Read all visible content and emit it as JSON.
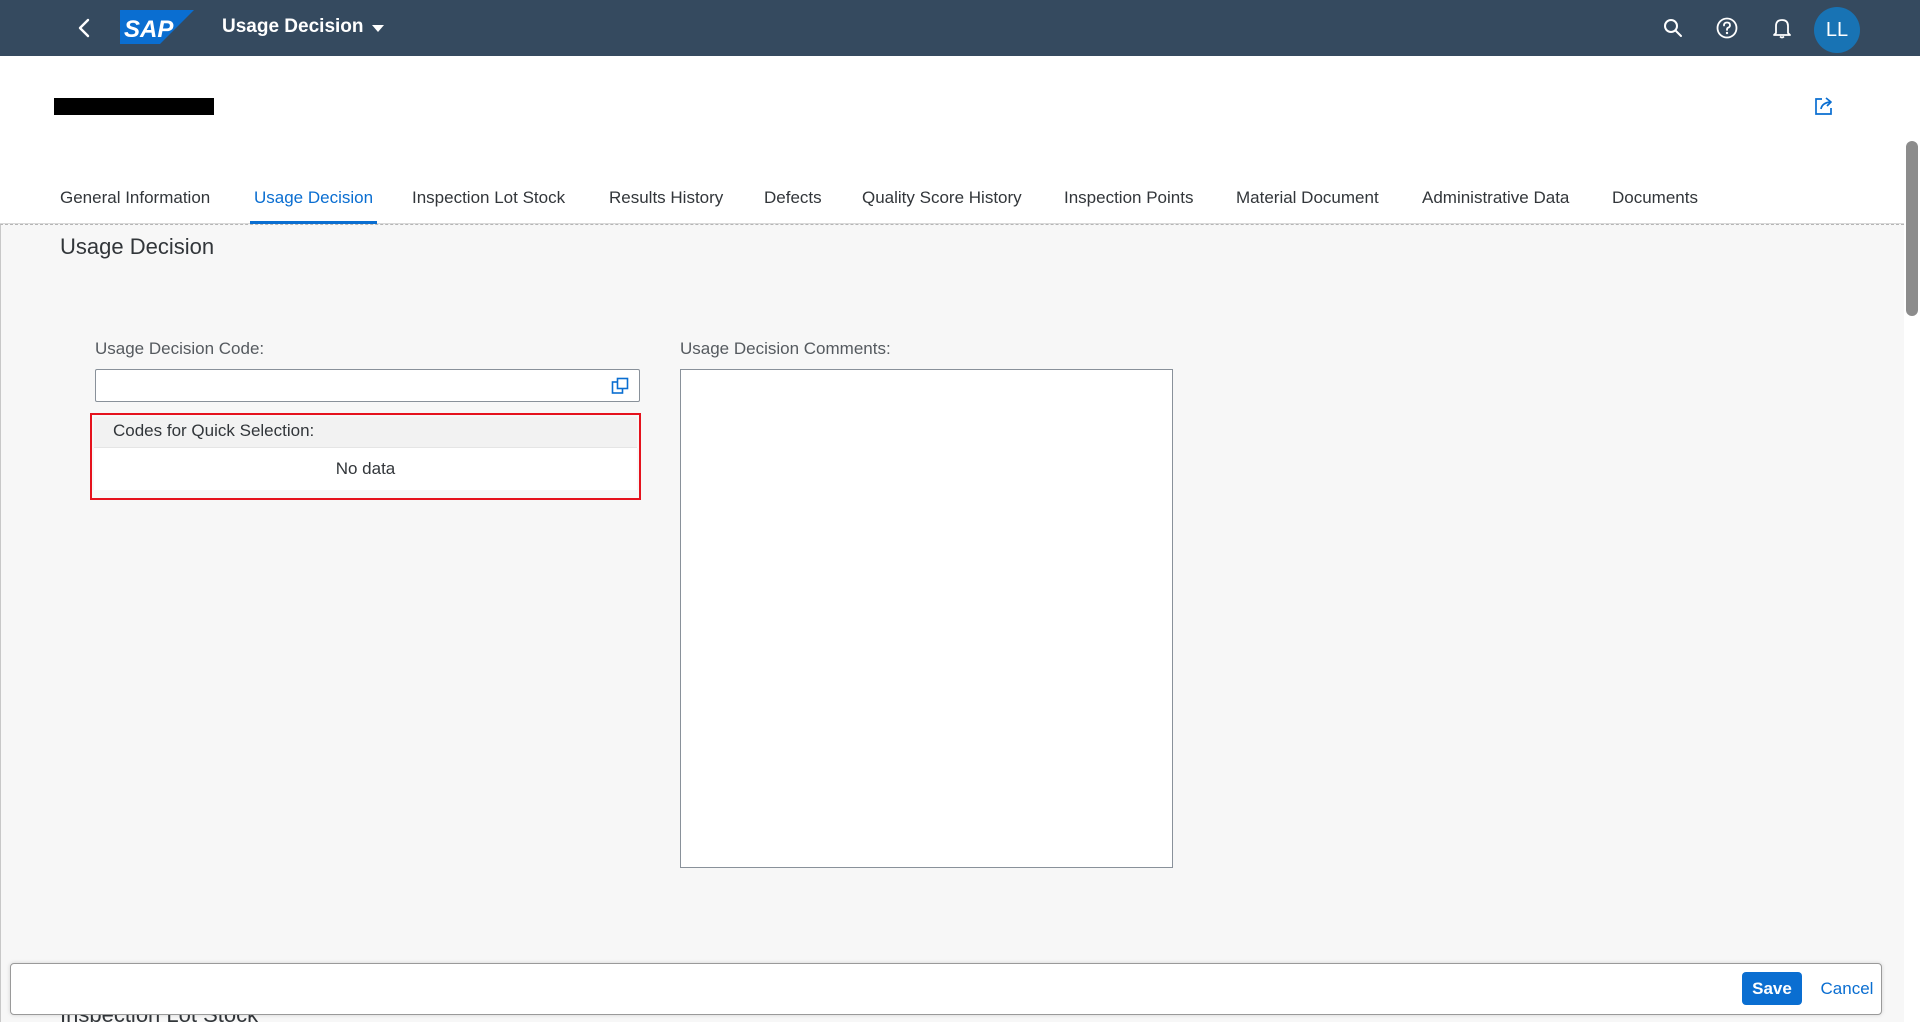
{
  "shell": {
    "app_title": "Usage Decision",
    "avatar_initials": "LL",
    "logo_text": "SAP",
    "icons": [
      "back-icon",
      "search-icon",
      "help-icon",
      "bell-icon",
      "share-icon",
      "value-help-icon"
    ]
  },
  "tabs": [
    {
      "label": "General Information",
      "active": false
    },
    {
      "label": "Usage Decision",
      "active": true
    },
    {
      "label": "Inspection Lot Stock",
      "active": false
    },
    {
      "label": "Results History",
      "active": false
    },
    {
      "label": "Defects",
      "active": false
    },
    {
      "label": "Quality Score History",
      "active": false
    },
    {
      "label": "Inspection Points",
      "active": false
    },
    {
      "label": "Material Document",
      "active": false
    },
    {
      "label": "Administrative Data",
      "active": false
    },
    {
      "label": "Documents",
      "active": false
    }
  ],
  "section": {
    "title": "Usage Decision",
    "code_label": "Usage Decision Code:",
    "code_value": "",
    "comments_label": "Usage Decision Comments:",
    "comments_value": "",
    "quick_selection_header": "Codes for Quick Selection:",
    "quick_selection_empty": "No data"
  },
  "next_section_title": "Inspection Lot Stock",
  "footer": {
    "save_label": "Save",
    "cancel_label": "Cancel"
  },
  "colors": {
    "shell_bg": "#354a5f",
    "accent": "#0a6ed1",
    "highlight_border": "#e5121d",
    "avatar_bg": "#1873b4"
  }
}
